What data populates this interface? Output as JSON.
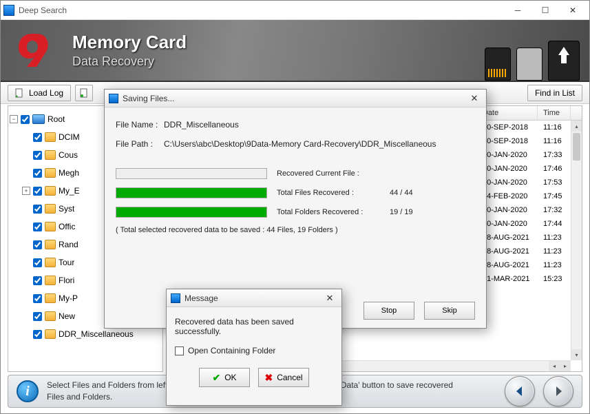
{
  "window": {
    "title": "Deep Search"
  },
  "banner": {
    "title": "Memory Card",
    "subtitle": "Data Recovery"
  },
  "toolbar": {
    "load_log": "Load Log",
    "find_in_list": "Find in List"
  },
  "tree": {
    "root": "Root",
    "items": [
      "DCIM",
      "Cous",
      "Megh",
      "My_E",
      "Syst",
      "Offic",
      "Rand",
      "Tour",
      "Flori",
      "My-P",
      "New",
      "DDR_Miscellaneous"
    ]
  },
  "list": {
    "headers": {
      "date": "Date",
      "time": "Time"
    },
    "rows": [
      {
        "date": "10-SEP-2018",
        "time": "11:16"
      },
      {
        "date": "10-SEP-2018",
        "time": "11:16"
      },
      {
        "date": "10-JAN-2020",
        "time": "17:33"
      },
      {
        "date": "10-JAN-2020",
        "time": "17:46"
      },
      {
        "date": "10-JAN-2020",
        "time": "17:53"
      },
      {
        "date": "04-FEB-2020",
        "time": "17:45"
      },
      {
        "date": "10-JAN-2020",
        "time": "17:32"
      },
      {
        "date": "10-JAN-2020",
        "time": "17:44"
      },
      {
        "date": "18-AUG-2021",
        "time": "11:23"
      },
      {
        "date": "18-AUG-2021",
        "time": "11:23"
      },
      {
        "date": "18-AUG-2021",
        "time": "11:23"
      },
      {
        "date": "31-MAR-2021",
        "time": "15:23"
      }
    ]
  },
  "footer": {
    "info": "i",
    "text_a": "Select Files and Folders from left P",
    "text_b": "Data' button to save recovered",
    "text_c": "Files and Folders."
  },
  "saving_dialog": {
    "title": "Saving Files...",
    "file_name_label": "File Name :",
    "file_name_value": "DDR_Miscellaneous",
    "file_path_label": "File Path :",
    "file_path_value": "C:\\Users\\abc\\Desktop\\9Data-Memory Card-Recovery\\DDR_Miscellaneous",
    "recovered_current_label": "Recovered Current File :",
    "total_files_label": "Total Files Recovered :",
    "total_files_value": "44 / 44",
    "total_folders_label": "Total Folders Recovered :",
    "total_folders_value": "19 / 19",
    "summary": "( Total selected recovered data to be saved : 44 Files, 19 Folders )",
    "stop": "Stop",
    "skip": "Skip"
  },
  "message_dialog": {
    "title": "Message",
    "body": "Recovered data has been saved successfully.",
    "checkbox_label": "Open Containing Folder",
    "ok": "OK",
    "cancel": "Cancel"
  }
}
